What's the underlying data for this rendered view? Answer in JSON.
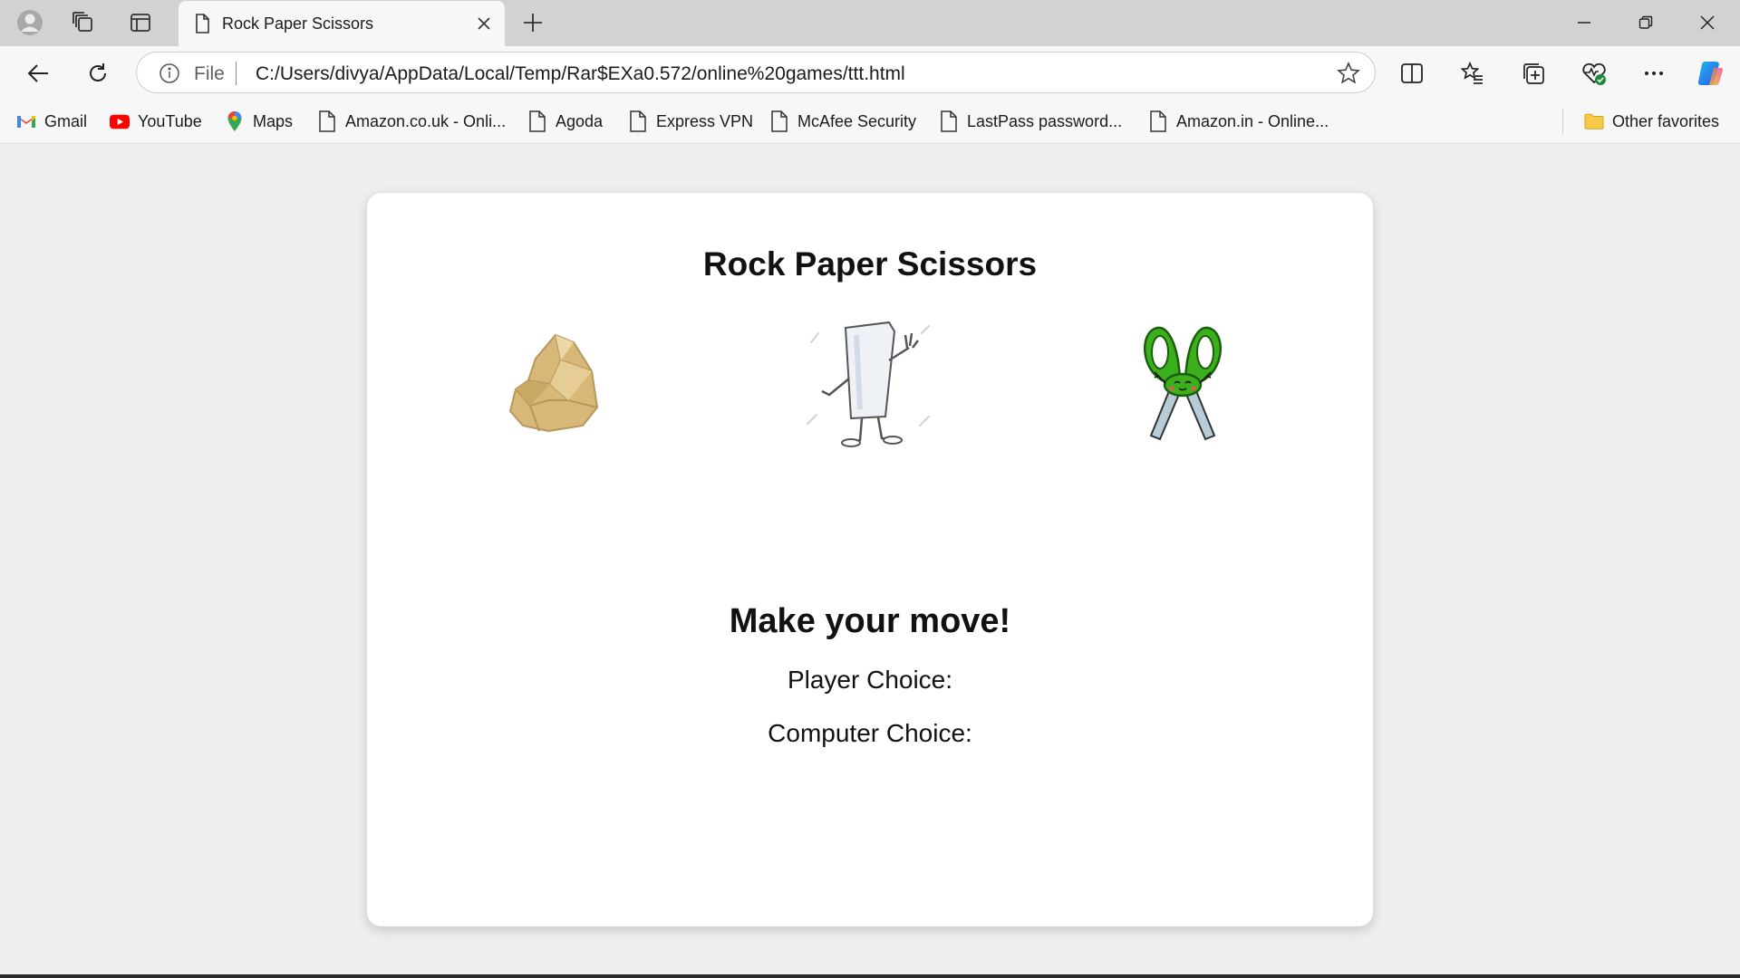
{
  "browser": {
    "tab": {
      "title": "Rock Paper Scissors",
      "icon": "page-icon"
    },
    "address": {
      "scheme_label": "File",
      "url": "C:/Users/divya/AppData/Local/Temp/Rar$EXa0.572/online%20games/ttt.html"
    },
    "favorites": [
      {
        "label": "Gmail",
        "icon": "gmail-icon"
      },
      {
        "label": "YouTube",
        "icon": "youtube-icon"
      },
      {
        "label": "Maps",
        "icon": "maps-icon"
      },
      {
        "label": "Amazon.co.uk - Onli...",
        "icon": "page-icon"
      },
      {
        "label": "Agoda",
        "icon": "page-icon"
      },
      {
        "label": "Express VPN",
        "icon": "page-icon"
      },
      {
        "label": "McAfee Security",
        "icon": "page-icon"
      },
      {
        "label": "LastPass password...",
        "icon": "page-icon"
      },
      {
        "label": "Amazon.in - Online...",
        "icon": "page-icon"
      }
    ],
    "other_favorites": "Other favorites"
  },
  "game": {
    "title": "Rock Paper Scissors",
    "choices": [
      "rock",
      "paper",
      "scissors"
    ],
    "status": "Make your move!",
    "player_choice_label": "Player Choice:",
    "computer_choice_label": "Computer Choice:"
  },
  "colors": {
    "accent_copilot": "#2a7fe8",
    "youtube_red": "#ff0000",
    "scissors_green": "#3cb01c",
    "rock_tan": "#d8b878"
  }
}
